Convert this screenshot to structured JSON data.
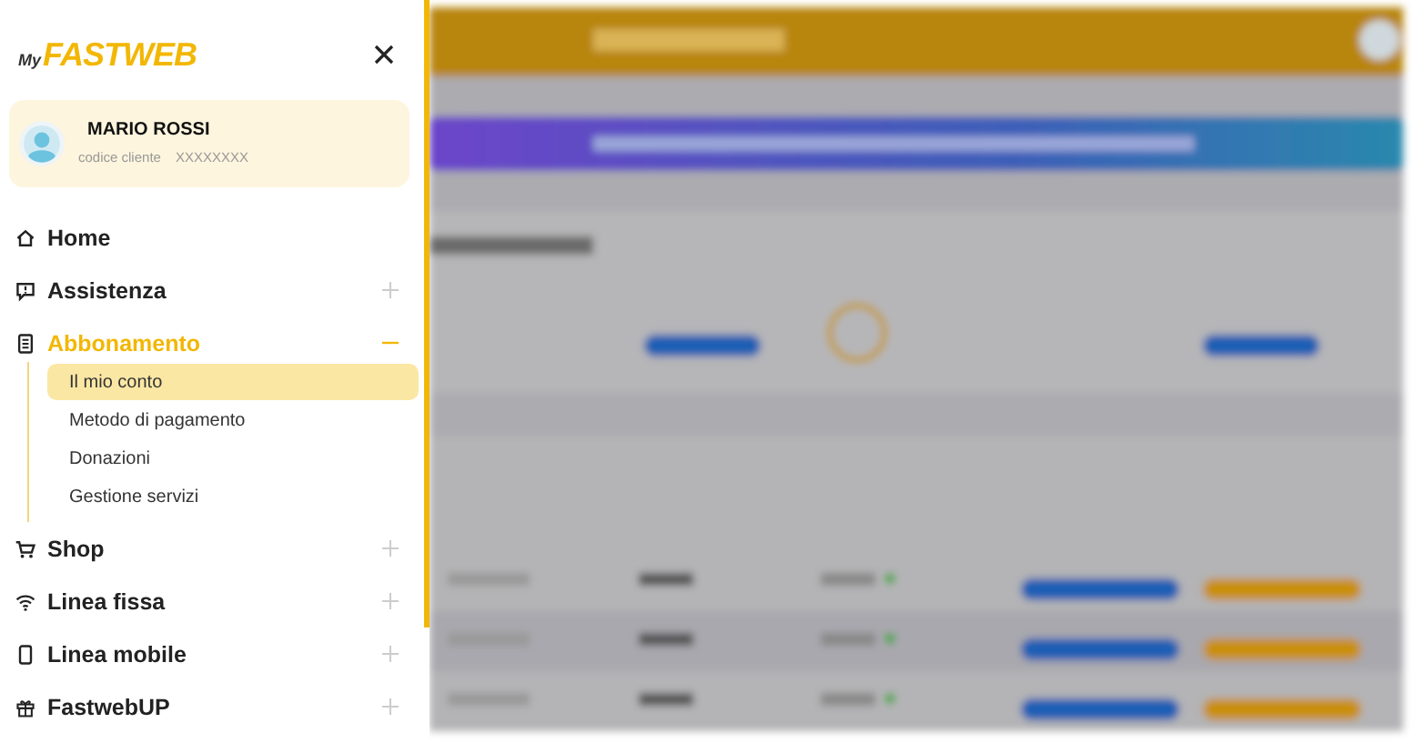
{
  "logo": {
    "prefix": "My",
    "name": "FASTWEB"
  },
  "profile": {
    "name": "MARIO ROSSI",
    "code_label": "codice cliente",
    "code": "XXXXXXXX"
  },
  "menu": [
    {
      "kind": "link",
      "label": "Home"
    },
    {
      "kind": "group",
      "label": "Assistenza",
      "expanded": false
    },
    {
      "kind": "group",
      "label": "Abbonamento",
      "expanded": true,
      "children": [
        {
          "label": "Il mio conto",
          "selected": true
        },
        {
          "label": "Metodo di pagamento",
          "selected": false
        },
        {
          "label": "Donazioni",
          "selected": false
        },
        {
          "label": "Gestione servizi",
          "selected": false
        }
      ]
    },
    {
      "kind": "group",
      "label": "Shop",
      "expanded": false
    },
    {
      "kind": "group",
      "label": "Linea fissa",
      "expanded": false
    },
    {
      "kind": "group",
      "label": "Linea mobile",
      "expanded": false
    },
    {
      "kind": "group",
      "label": "FastwebUP",
      "expanded": false
    }
  ]
}
